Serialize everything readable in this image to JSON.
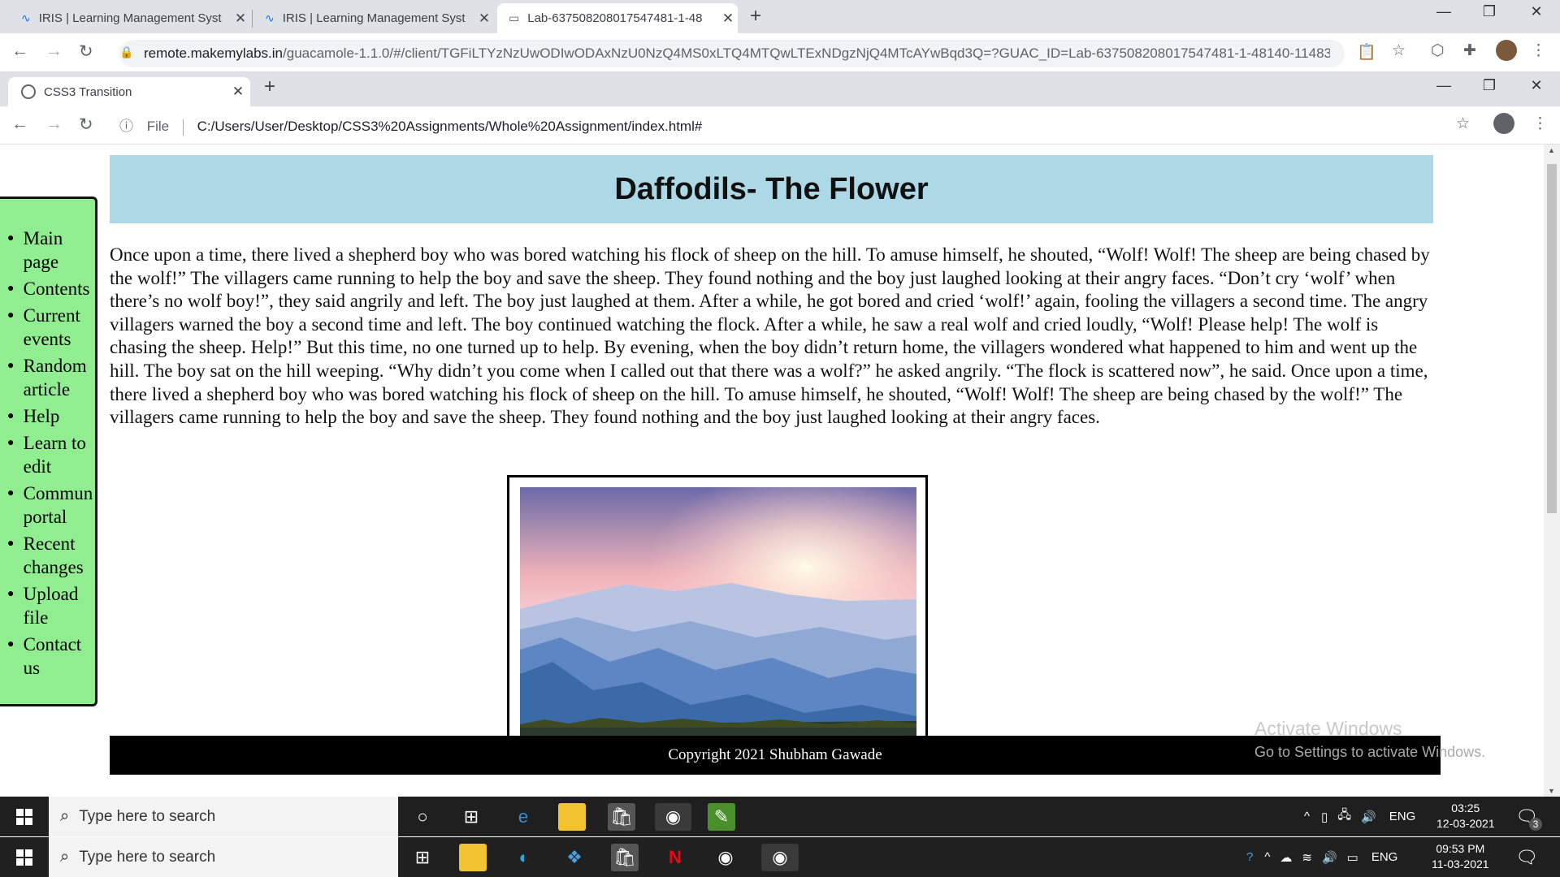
{
  "outer_browser": {
    "tabs": [
      {
        "title": "IRIS | Learning Management Syst"
      },
      {
        "title": "IRIS | Learning Management Syst"
      },
      {
        "title": "Lab-637508208017547481-1-48"
      }
    ],
    "url_host": "remote.makemylabs.in",
    "url_rest": "/guacamole-1.1.0/#/client/TGFiLTYzNzUwODIwODAxNzU0NzQ4MS0xLTQ4MTQwLTExNDgzNjQ4MTcAYwBqd3Q=?GUAC_ID=Lab-637508208017547481-1-48140-11483..."
  },
  "inner_browser": {
    "tab_title": "CSS3 Transition",
    "url_prefix": "File",
    "url": "C:/Users/User/Desktop/CSS3%20Assignments/Whole%20Assignment/index.html#"
  },
  "page": {
    "title": "Daffodils- The Flower",
    "sidebar_items": [
      {
        "label": "Main page"
      },
      {
        "label": "Contents"
      },
      {
        "label": "Current events"
      },
      {
        "label": "Random article"
      },
      {
        "label": "Help"
      },
      {
        "label": "Learn to edit"
      },
      {
        "label": "Commun portal"
      },
      {
        "label": "Recent changes"
      },
      {
        "label": "Upload file"
      },
      {
        "label": "Contact us"
      }
    ],
    "story": "Once upon a time, there lived a shepherd boy who was bored watching his flock of sheep on the hill. To amuse himself, he shouted, “Wolf! Wolf! The sheep are being chased by the wolf!” The villagers came running to help the boy and save the sheep. They found nothing and the boy just laughed looking at their angry faces. “Don’t cry ‘wolf’ when there’s no wolf boy!”, they said angrily and left. The boy just laughed at them. After a while, he got bored and cried ‘wolf!’ again, fooling the villagers a second time. The angry villagers warned the boy a second time and left. The boy continued watching the flock. After a while, he saw a real wolf and cried loudly, “Wolf! Please help! The wolf is chasing the sheep. Help!” But this time, no one turned up to help. By evening, when the boy didn’t return home, the villagers wondered what happened to him and went up the hill. The boy sat on the hill weeping. “Why didn’t you come when I called out that there was a wolf?” he asked angrily. “The flock is scattered now”, he said. Once upon a time, there lived a shepherd boy who was bored watching his flock of sheep on the hill. To amuse himself, he shouted, “Wolf! Wolf! The sheep are being chased by the wolf!” The villagers came running to help the boy and save the sheep. They found nothing and the boy just laughed looking at their angry faces.",
    "footer": "Copyright 2021 Shubham Gawade",
    "watermark_title": "Activate Windows",
    "watermark_sub": "Go to Settings to activate Windows."
  },
  "taskbar_remote": {
    "search_placeholder": "Type here to search",
    "lang": "ENG",
    "time": "03:25",
    "date": "12-03-2021",
    "notif_count": "3"
  },
  "taskbar_local": {
    "search_placeholder": "Type here to search",
    "lang": "ENG",
    "time": "09:53 PM",
    "date": "11-03-2021"
  },
  "colors": {
    "banner": "#add8e6",
    "sidebar": "#90ee90",
    "footer": "#000000"
  }
}
